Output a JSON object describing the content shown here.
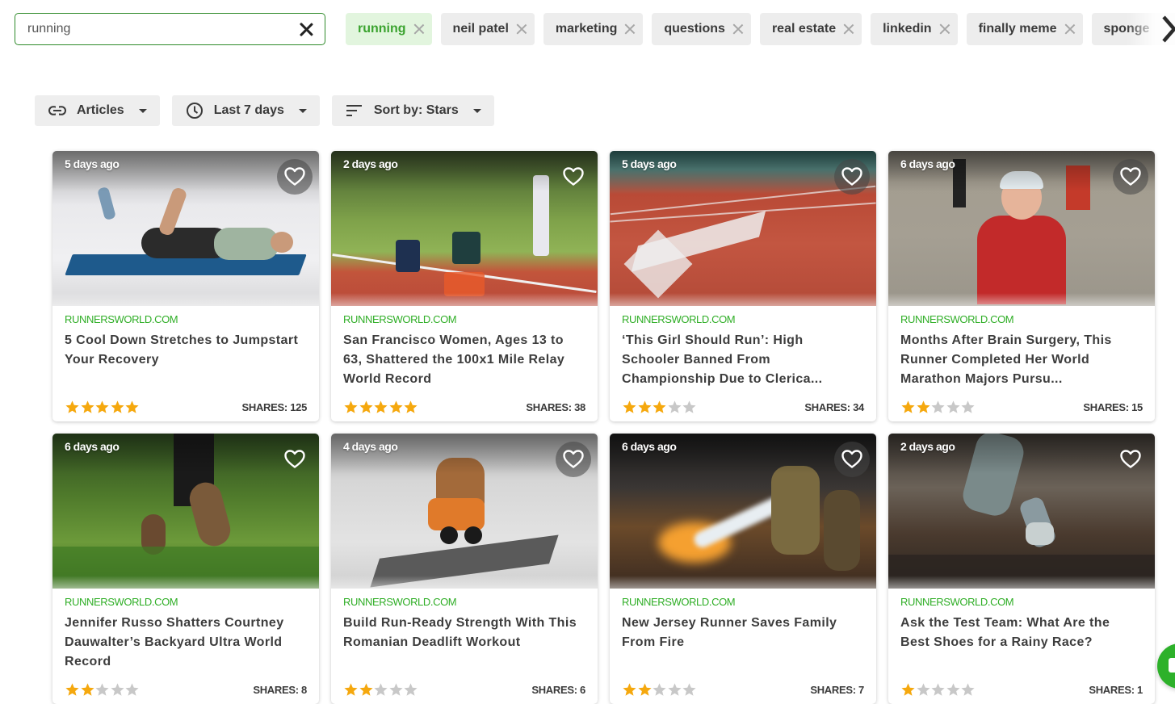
{
  "search": {
    "value": "running",
    "placeholder": ""
  },
  "chips": [
    {
      "label": "running",
      "active": true
    },
    {
      "label": "neil patel",
      "active": false
    },
    {
      "label": "marketing",
      "active": false
    },
    {
      "label": "questions",
      "active": false
    },
    {
      "label": "real estate",
      "active": false
    },
    {
      "label": "linkedin",
      "active": false
    },
    {
      "label": "finally meme",
      "active": false
    },
    {
      "label": "sponge",
      "active": false
    }
  ],
  "filters": {
    "type": {
      "label": "Articles",
      "icon": "link-icon"
    },
    "time": {
      "label": "Last 7 days",
      "icon": "clock-icon"
    },
    "sort": {
      "label": "Sort by: Stars",
      "icon": "sort-icon"
    }
  },
  "colors": {
    "accent_green": "#2fae26",
    "star_filled": "#f5a80e",
    "star_empty": "#c8c8c8"
  },
  "cards": [
    {
      "age": "5 days ago",
      "source": "RUNNERSWORLD.COM",
      "title": "5 Cool Down Stretches to Jumpstart Your Recovery",
      "stars": 5,
      "shares": "SHARES: 125",
      "image": "woman stretching on yoga mat"
    },
    {
      "age": "2 days ago",
      "source": "RUNNERSWORLD.COM",
      "title": "San Francisco Women, Ages 13 to 63, Shattered the 100x1 Mile Relay World Record",
      "stars": 5,
      "shares": "SHARES: 38",
      "image": "relay baton handoff on track"
    },
    {
      "age": "5 days ago",
      "source": "RUNNERSWORLD.COM",
      "title": "‘This Girl Should Run’: High Schooler Banned From Championship Due to Clerica...",
      "stars": 3,
      "shares": "SHARES: 34",
      "image": "red running track with arrow"
    },
    {
      "age": "6 days ago",
      "source": "RUNNERSWORLD.COM",
      "title": "Months After Brain Surgery, This Runner Completed Her World Marathon Majors Pursu...",
      "stars": 2,
      "shares": "SHARES: 15",
      "image": "runner holding medals"
    },
    {
      "age": "6 days ago",
      "source": "RUNNERSWORLD.COM",
      "title": "Jennifer Russo Shatters Courtney Dauwalter’s Backyard Ultra World Record",
      "stars": 2,
      "shares": "SHARES: 8",
      "image": "trail runner feet in forest"
    },
    {
      "age": "4 days ago",
      "source": "RUNNERSWORLD.COM",
      "title": "Build Run-Ready Strength With This Romanian Deadlift Workout",
      "stars": 2,
      "shares": "SHARES: 6",
      "image": "man lifting kettlebells"
    },
    {
      "age": "6 days ago",
      "source": "RUNNERSWORLD.COM",
      "title": "New Jersey Runner Saves Family From Fire",
      "stars": 2,
      "shares": "SHARES: 7",
      "image": "firefighters spraying water"
    },
    {
      "age": "2 days ago",
      "source": "RUNNERSWORLD.COM",
      "title": "Ask the Test Team: What Are the Best Shoes for a Rainy Race?",
      "stars": 1,
      "shares": "SHARES: 1",
      "image": "runner splashing in rain"
    }
  ]
}
